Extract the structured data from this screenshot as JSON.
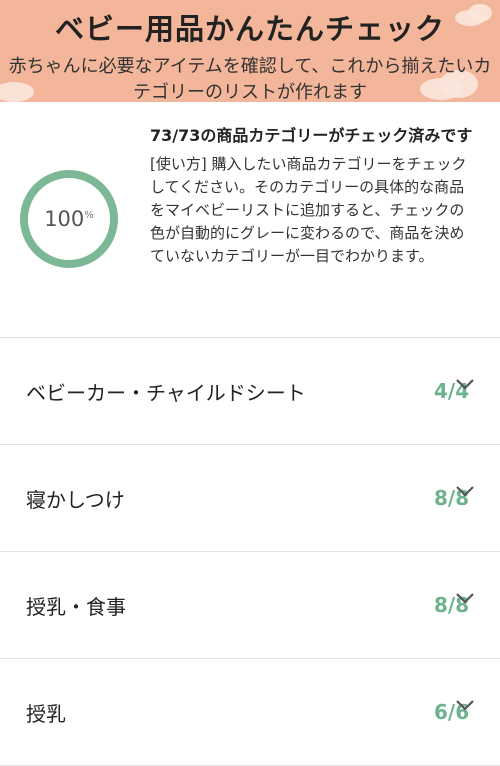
{
  "header": {
    "title": "ベビー用品かんたんチェック",
    "subtitle": "赤ちゃんに必要なアイテムを確認して、これから揃えたいカテゴリーのリストが作れます"
  },
  "summary": {
    "progress_percent": 100,
    "percent_value": "100",
    "percent_unit": "%",
    "title": "73/73の商品カテゴリーがチェック済みです",
    "description": "[使い方] 購入したい商品カテゴリーをチェックしてください。そのカテゴリーの具体的な商品をマイベビーリストに追加すると、チェックの色が自動的にグレーに変わるので、商品を決めていないカテゴリーが一目でわかります。"
  },
  "categories": [
    {
      "name": "ベビーカー・チャイルドシート",
      "count": "4/4"
    },
    {
      "name": "寝かしつけ",
      "count": "8/8"
    },
    {
      "name": "授乳・食事",
      "count": "8/8"
    },
    {
      "name": "授乳",
      "count": "6/6"
    }
  ],
  "colors": {
    "header_bg": "#f4b69a",
    "accent_green": "#7cb796",
    "count_green": "#6fb38e"
  },
  "icons": {
    "expand": "chevron-down-icon"
  }
}
